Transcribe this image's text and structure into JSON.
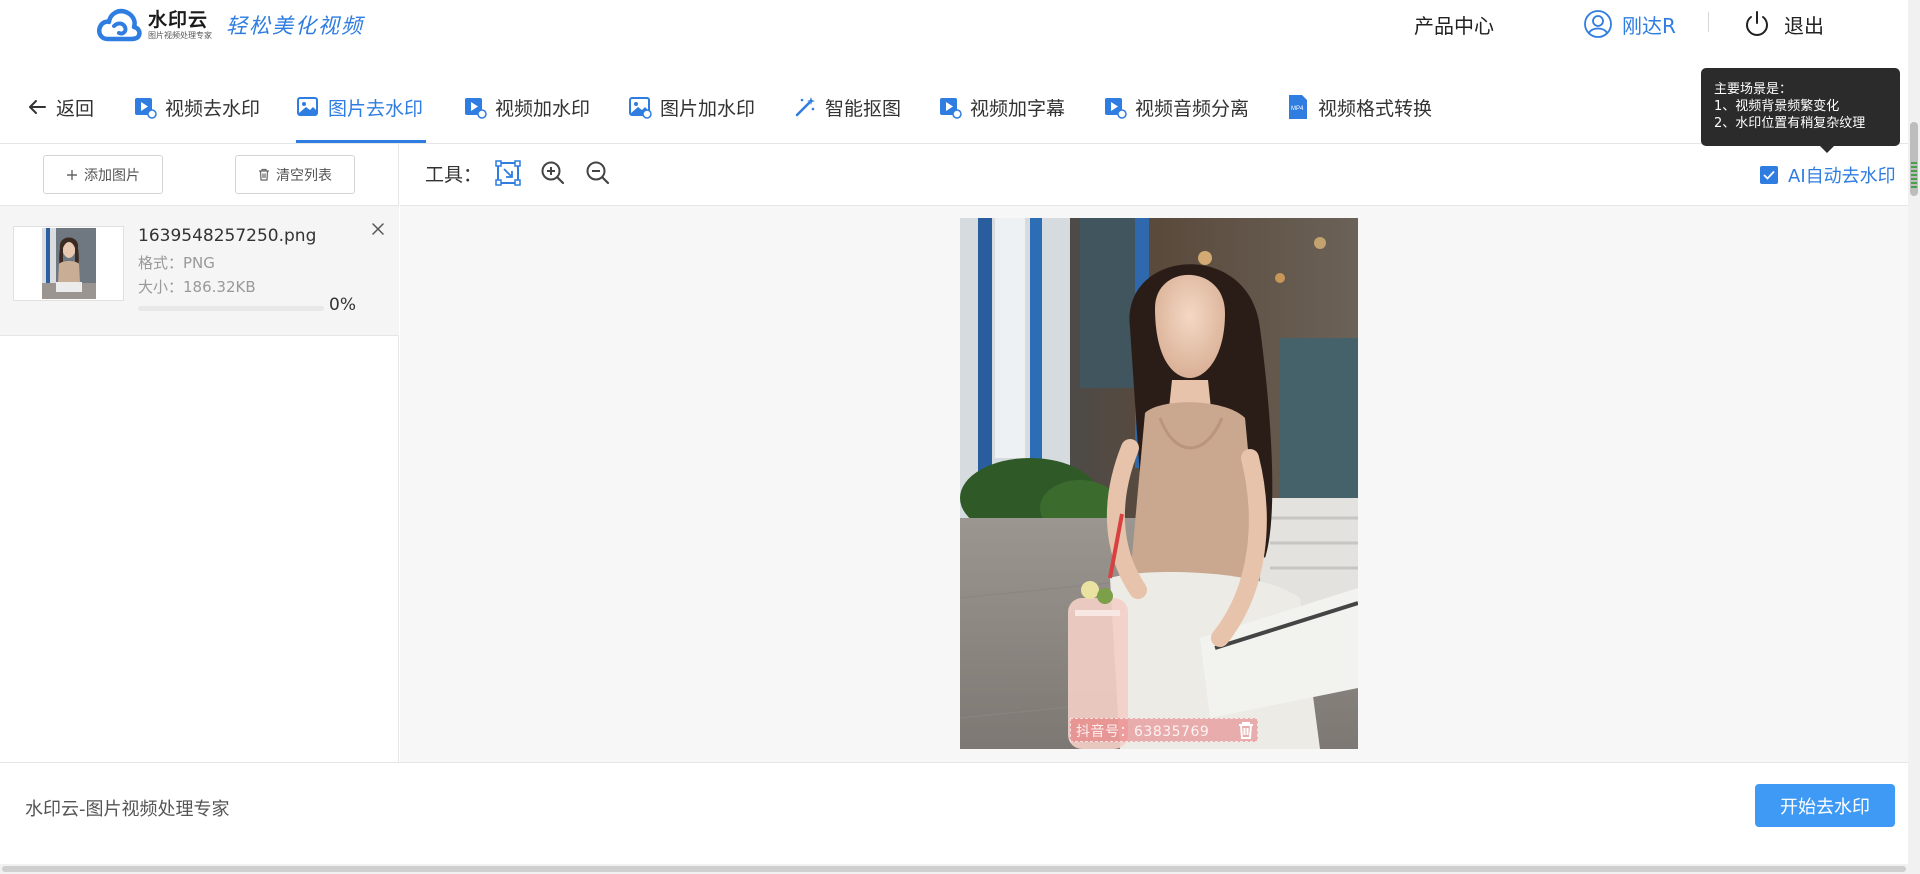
{
  "header": {
    "logo_title": "水印云",
    "logo_subtitle": "图片视频处理专家",
    "slogan": "轻松美化视频",
    "product_center": "产品中心",
    "username": "刚达R",
    "logout": "退出"
  },
  "nav": {
    "back": "返回",
    "tabs": [
      {
        "label": "视频去水印",
        "icon": "video-icon"
      },
      {
        "label": "图片去水印",
        "icon": "image-icon",
        "active": true
      },
      {
        "label": "视频加水印",
        "icon": "video-icon"
      },
      {
        "label": "图片加水印",
        "icon": "image-add-icon"
      },
      {
        "label": "智能抠图",
        "icon": "magic-wand-icon"
      },
      {
        "label": "视频加字幕",
        "icon": "video-icon"
      },
      {
        "label": "视频音频分离",
        "icon": "video-icon"
      },
      {
        "label": "视频格式转换",
        "icon": "mp4-file-icon"
      }
    ]
  },
  "left_panel": {
    "add_image": "添加图片",
    "clear_list": "清空列表",
    "file": {
      "name": "1639548257250.png",
      "format": "格式：PNG",
      "size": "大小：186.32KB",
      "progress": 0,
      "progress_text": "0%"
    }
  },
  "toolbar": {
    "tools_label": "工具：",
    "ai_auto_label": "AI自动去水印",
    "ai_auto_checked": true
  },
  "tooltip": {
    "lines": [
      "主要场景是：",
      "1、视频背景频繁变化",
      "2、水印位置有稍复杂纹理"
    ]
  },
  "canvas": {
    "watermark_text": "抖音号：63835769"
  },
  "footer": {
    "text": "水印云-图片视频处理专家",
    "start_button": "开始去水印"
  },
  "colors": {
    "accent": "#2f7de1",
    "button": "#3f9af5",
    "tooltip_bg": "#2b2b2b"
  }
}
